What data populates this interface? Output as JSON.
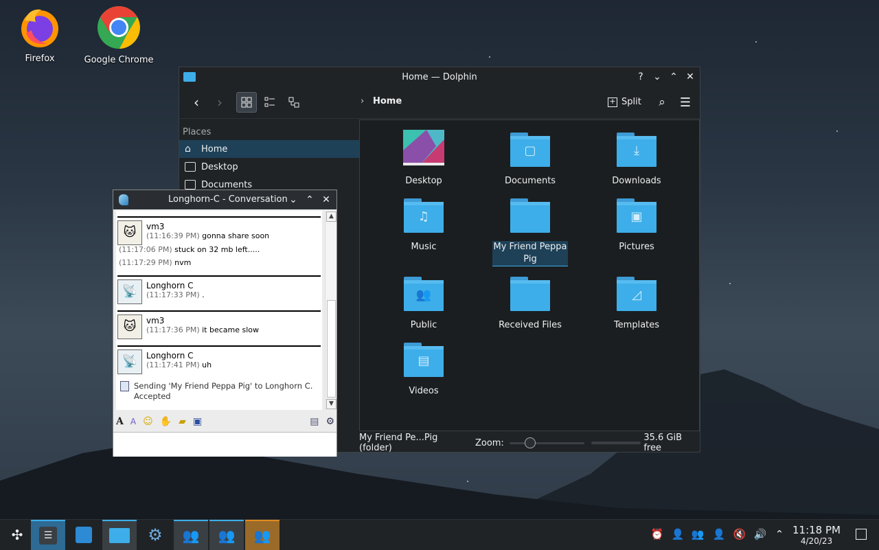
{
  "desktop": {
    "icons": [
      {
        "label": "Firefox",
        "icon": "firefox-icon"
      },
      {
        "label": "Google Chrome",
        "icon": "chrome-icon"
      }
    ]
  },
  "dolphin": {
    "title": "Home — Dolphin",
    "breadcrumb": "Home",
    "split_label": "Split",
    "places_header": "Places",
    "places": [
      {
        "label": "Home",
        "icon": "home-icon",
        "selected": true
      },
      {
        "label": "Desktop",
        "icon": "desktop-icon"
      },
      {
        "label": "Documents",
        "icon": "documents-icon"
      }
    ],
    "items": [
      {
        "label": "Desktop"
      },
      {
        "label": "Documents"
      },
      {
        "label": "Downloads"
      },
      {
        "label": "Music"
      },
      {
        "label": "My Friend Peppa Pig",
        "selected": true
      },
      {
        "label": "Pictures"
      },
      {
        "label": "Public"
      },
      {
        "label": "Received Files"
      },
      {
        "label": "Templates"
      },
      {
        "label": "Videos"
      }
    ],
    "status": {
      "selection": "My Friend Pe...Pig (folder)",
      "zoom_label": "Zoom:",
      "free_space": "35.6 GiB free"
    }
  },
  "conversation": {
    "title": "Longhorn-C - Conversation",
    "messages": [
      {
        "sender": "vm3",
        "time": "(11:16:39 PM)",
        "text": "gonna share soon"
      },
      {
        "time": "(11:17:06 PM)",
        "text": "stuck on 32 mb left....."
      },
      {
        "time": "(11:17:29 PM)",
        "text": "nvm"
      },
      {
        "sender": "Longhorn C",
        "time": "(11:17:33 PM)",
        "text": "."
      },
      {
        "sender": "vm3",
        "time": "(11:17:36 PM)",
        "text": "it became slow"
      },
      {
        "sender": "Longhorn C",
        "time": "(11:17:41 PM)",
        "text": "uh"
      }
    ],
    "file_transfer": "Sending 'My Friend Peppa Pig' to Longhorn C.",
    "file_status": "Accepted"
  },
  "taskbar": {
    "clock_time": "11:18 PM",
    "clock_date": "4/20/23"
  }
}
